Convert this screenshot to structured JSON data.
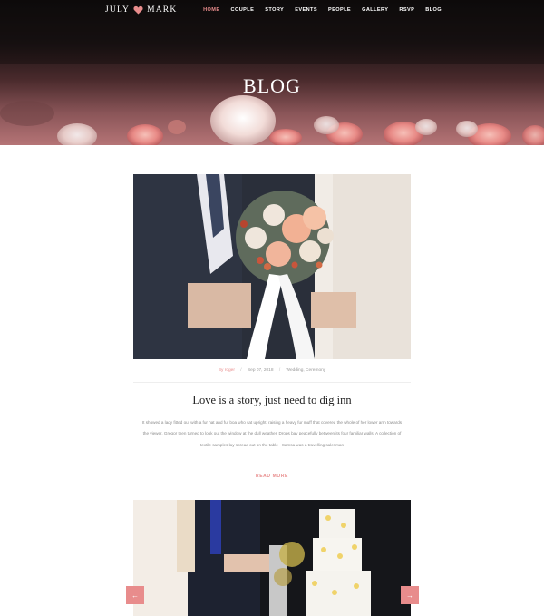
{
  "brand": {
    "name_left": "JULY",
    "name_right": "MARK"
  },
  "nav": {
    "items": [
      {
        "label": "HOME"
      },
      {
        "label": "COUPLE"
      },
      {
        "label": "STORY"
      },
      {
        "label": "EVENTS"
      },
      {
        "label": "PEOPLE"
      },
      {
        "label": "GALLERY"
      },
      {
        "label": "RSVP"
      },
      {
        "label": "BLOG"
      }
    ]
  },
  "hero": {
    "title": "BLOG"
  },
  "post": {
    "author": "By roger",
    "date": "Sep 07, 2018",
    "categories": "Wedding, Ceremony",
    "title": "Love is a story, just need to dig inn",
    "excerpt": "It showed a lady fitted out with a fur hat and fur boa who sat upright, raising a heavy fur muff that covered the whole of her lower arm towards the viewer. Gregor then turned to look out the window at the dull weather. Drops bay peacefully between its four familiar walls. A collection of textile samples lay spread out on the table - Samsa was a travelling salesman",
    "read_more": "READ MORE"
  },
  "carousel": {
    "prev": "←",
    "next": "→"
  },
  "colors": {
    "accent": "#e88c8c",
    "text_dark": "#222222",
    "text_muted": "#8a8a8a"
  }
}
